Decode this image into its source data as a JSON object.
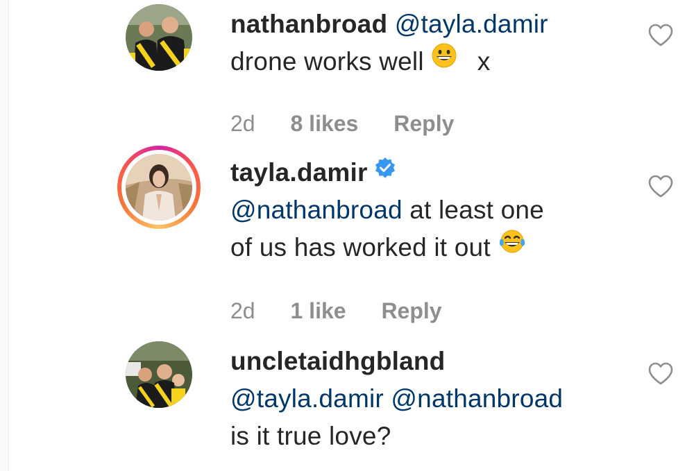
{
  "comments": [
    {
      "username": "nathanbroad",
      "mention": "@tayla.damir",
      "text": "drone works well",
      "suffix": "x",
      "emoji": "grinning-face-emoji",
      "age": "2d",
      "likes": "8 likes",
      "reply": "Reply"
    },
    {
      "username": "tayla.damir",
      "verified": true,
      "mention": "@nathanbroad",
      "text_line1": "at least one",
      "text_line2": "of us has worked it out",
      "emoji": "face-with-tears-of-joy-emoji",
      "age": "2d",
      "likes": "1 like",
      "reply": "Reply",
      "has_story_ring": true
    },
    {
      "username": "uncletaidhgbland",
      "mention1": "@tayla.damir",
      "mention2": "@nathanbroad",
      "text": "is it true love?"
    }
  ],
  "colors": {
    "text": "#262626",
    "mention": "#00376b",
    "meta": "#8e8e8e",
    "verified": "#3897f0",
    "heart_outline": "#8e8e8e"
  }
}
